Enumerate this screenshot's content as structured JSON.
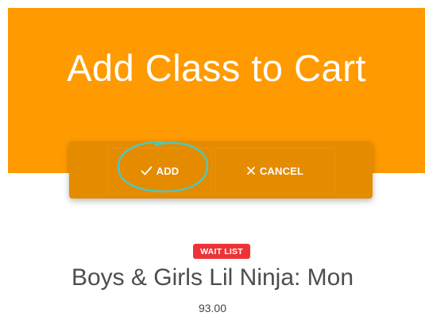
{
  "header": {
    "title": "Add Class to Cart"
  },
  "actions": {
    "add_label": "ADD",
    "add_icon": "checkmark-icon",
    "cancel_label": "CANCEL",
    "cancel_icon": "x-icon"
  },
  "class": {
    "status_badge": "WAIT LIST",
    "name": "Boys & Girls Lil Ninja: Mon",
    "price": "93.00"
  },
  "colors": {
    "hero_background": "#ff9a00",
    "action_bar": "#e58b00",
    "badge": "#ee3338",
    "highlight_circle": "#4cc9c0"
  }
}
